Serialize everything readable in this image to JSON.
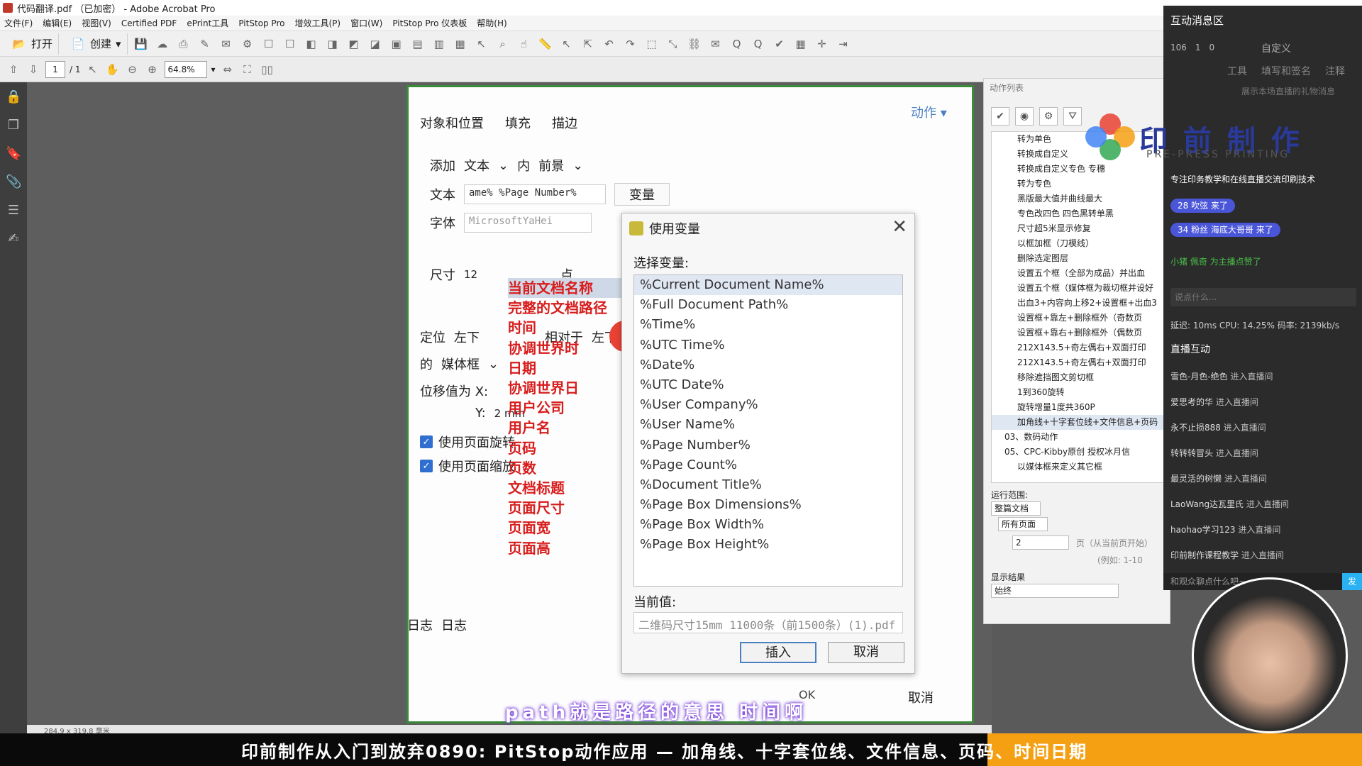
{
  "titlebar": {
    "title": "代码翻译.pdf （已加密） - Adobe Acrobat Pro"
  },
  "menu": {
    "items": [
      "文件(F)",
      "编辑(E)",
      "视图(V)",
      "Certified PDF",
      "ePrint工具",
      "PitStop Pro",
      "增效工具(P)",
      "窗口(W)",
      "PitStop Pro 仪表板",
      "帮助(H)"
    ]
  },
  "toolbar": {
    "open_label": "打开",
    "create_label": "创建"
  },
  "nav": {
    "page_current": "1",
    "page_total": "/ 1",
    "zoom": "64.8%"
  },
  "doc_status": {
    "size": "284.9 x 319.8 毫米"
  },
  "props": {
    "tabs": [
      "对象和位置",
      "填充",
      "描边"
    ],
    "action_label": "动作",
    "add_label": "添加",
    "add_type": "文本",
    "add_in": "内",
    "add_layer": "前景",
    "text_label": "文本",
    "text_value": "ame% %Page Number%",
    "variable_btn": "变量",
    "font_label": "字体",
    "font_value": "MicrosoftYaHei",
    "size_label": "尺寸",
    "size_value": "12",
    "size_unit": "点",
    "position_label": "定位",
    "position_value": "左下",
    "relative_label": "相对于",
    "relative_value": "左下",
    "of_label": "的",
    "of_value": "媒体框",
    "offset_label": "位移值为 X:",
    "offset_y_label": "Y:",
    "offset_y_value": "2 mm",
    "use_rotation": "使用页面旋转",
    "use_scale": "使用页面缩放",
    "log_label": "日志",
    "log_value": "日志",
    "ok_label": "OK",
    "cancel_label": "取消"
  },
  "annotations": [
    "当前文档名称",
    "完整的文档路径",
    "时间",
    "协调世界时",
    "日期",
    "协调世界日",
    "用户公司",
    "用户名",
    "页码",
    "页数",
    "文档标题",
    "页面尺寸",
    "页面宽",
    "页面高"
  ],
  "dialog": {
    "title": "使用变量",
    "select_label": "选择变量:",
    "variables": [
      "%Current Document Name%",
      "%Full Document Path%",
      "%Time%",
      "%UTC Time%",
      "%Date%",
      "%UTC Date%",
      "%User Company%",
      "%User Name%",
      "%Page Number%",
      "%Page Count%",
      "%Document Title%",
      "%Page Box Dimensions%",
      "%Page Box Width%",
      "%Page Box Height%"
    ],
    "current_label": "当前值:",
    "current_value": "二维码尺寸15mm 11000条（前1500条）(1).pdf",
    "insert_label": "插入",
    "cancel_label": "取消"
  },
  "action_panel": {
    "header": "动作列表",
    "items": [
      "转为单色",
      "转换成自定义",
      "转换成自定义专色 专穗",
      "转为专色",
      "黑版最大值并曲线最大",
      "专色改四色 四色黑转单黑",
      "尺寸超5米显示修复",
      "以框加框（刀模线）",
      "删除选定图层",
      "设置五个框（全部为成品）并出血",
      "设置五个框（媒体框为裁切框并设好",
      "出血3+内容向上移2+设置框+出血3",
      "设置框+靠左+删除框外（奇数页",
      "设置框+靠右+删除框外（偶数页",
      "212X143.5+奇左偶右+双面打印",
      "212X143.5+奇左偶右+双面打印",
      "移除遮挡图文剪切框",
      "1到360旋转",
      "旋转增量1度共360P",
      "加角线+十字套位线+文件信息+页码",
      "03、数码动作",
      "05、CPC-Kibby原创 授权冰月信",
      "以媒体框来定义其它框"
    ],
    "range_label": "运行范围:",
    "range_value": "整篇文档",
    "pages_value": "所有页面",
    "page_from": "2",
    "page_hint": "页（从当前页开始）",
    "example_hint": "(例如: 1-10",
    "result_label": "显示结果",
    "result_value": "始终"
  },
  "interact": {
    "title": "互动消息区",
    "stats": [
      "106",
      "1",
      "0"
    ],
    "custom": "自定义",
    "tabs": [
      "工具",
      "填写和签名",
      "注释"
    ],
    "gift_hint": "展示本场直播的礼物消息",
    "tagline": "专注印务教学和在线直播交流印刷技术",
    "pills": [
      "28 吹弦 来了",
      "34 粉丝 海底大哥哥 来了"
    ],
    "gift": "小猪 佩奇 为主播点赞了",
    "input_placeholder": "说点什么...",
    "status": "延迟: 10ms  CPU: 14.25%  码率: 2139kb/s",
    "live_title": "直播互动",
    "entries": [
      {
        "who": "雪色-月色-绝色",
        "what": "进入直播间"
      },
      {
        "who": "爱思考的华",
        "what": "进入直播间"
      },
      {
        "who": "永不止损888",
        "what": "进入直播间"
      },
      {
        "who": "转转转冒头",
        "what": "进入直播间"
      },
      {
        "who": "最灵活的树懒",
        "what": "进入直播间"
      },
      {
        "who": "LaoWang达瓦里氏",
        "what": "进入直播间"
      },
      {
        "who": "haohao学习123",
        "what": "进入直播间"
      },
      {
        "who": "印前制作课程教学",
        "what": "进入直播间"
      }
    ],
    "bottom_placeholder": "和观众聊点什么吧~",
    "send_label": "发"
  },
  "logo": {
    "main": "印 前 制 作",
    "sub": "PRE-PRESS  PRINTING"
  },
  "caption": "path就是路径的意思 时间啊",
  "banner": "印前制作从入门到放弃0890: PitStop动作应用 — 加角线、十字套位线、文件信息、页码、时间日期",
  "colors": {
    "accent": "#4a7fc1",
    "annotation": "#d81d1d",
    "frame": "#3a8a3a",
    "banner_accent": "#f5a013"
  }
}
